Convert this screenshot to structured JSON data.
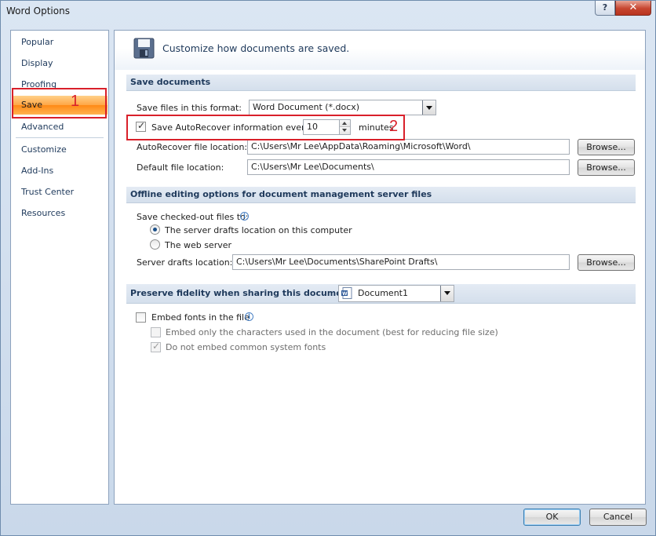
{
  "window": {
    "title": "Word Options",
    "help_label": "?",
    "close_label": "✕"
  },
  "sidebar": {
    "items": [
      {
        "label": "Popular"
      },
      {
        "label": "Display"
      },
      {
        "label": "Proofing"
      },
      {
        "label": "Save"
      },
      {
        "label": "Advanced"
      },
      {
        "label": "Customize"
      },
      {
        "label": "Add-Ins"
      },
      {
        "label": "Trust Center"
      },
      {
        "label": "Resources"
      }
    ],
    "active": "Save"
  },
  "annotations": {
    "callout_1": "1",
    "callout_2": "2",
    "color": "#d9202a"
  },
  "banner": {
    "text": "Customize how documents are saved."
  },
  "save_documents": {
    "header": "Save documents",
    "format_label": "Save files in this format:",
    "format_value": "Word Document (*.docx)",
    "autorecover_label": "Save AutoRecover information every",
    "autorecover_checked": true,
    "autorecover_minutes": "10",
    "minutes_label": "minutes",
    "autorecover_location_label": "AutoRecover file location:",
    "autorecover_location_value": "C:\\Users\\Mr Lee\\AppData\\Roaming\\Microsoft\\Word\\",
    "default_location_label": "Default file location:",
    "default_location_value": "C:\\Users\\Mr Lee\\Documents\\",
    "browse_label": "Browse..."
  },
  "offline": {
    "header": "Offline editing options for document management server files",
    "save_to_label": "Save checked-out files to:",
    "option_server_drafts": "The server drafts location on this computer",
    "option_web_server": "The web server",
    "selected": "server_drafts",
    "server_drafts_label": "Server drafts location:",
    "server_drafts_value": "C:\\Users\\Mr Lee\\Documents\\SharePoint Drafts\\",
    "browse_label": "Browse..."
  },
  "fidelity": {
    "header": "Preserve fidelity when sharing this document:",
    "document_value": "Document1",
    "embed_fonts_label": "Embed fonts in the file",
    "embed_fonts_checked": false,
    "embed_chars_label": "Embed only the characters used in the document (best for reducing file size)",
    "embed_chars_checked": false,
    "no_common_fonts_label": "Do not embed common system fonts",
    "no_common_fonts_checked": true
  },
  "footer": {
    "ok_label": "OK",
    "cancel_label": "Cancel"
  },
  "colors": {
    "accent_orange": "#ff8a16",
    "section_text": "#1e395b",
    "highlight_red": "#d9202a"
  }
}
